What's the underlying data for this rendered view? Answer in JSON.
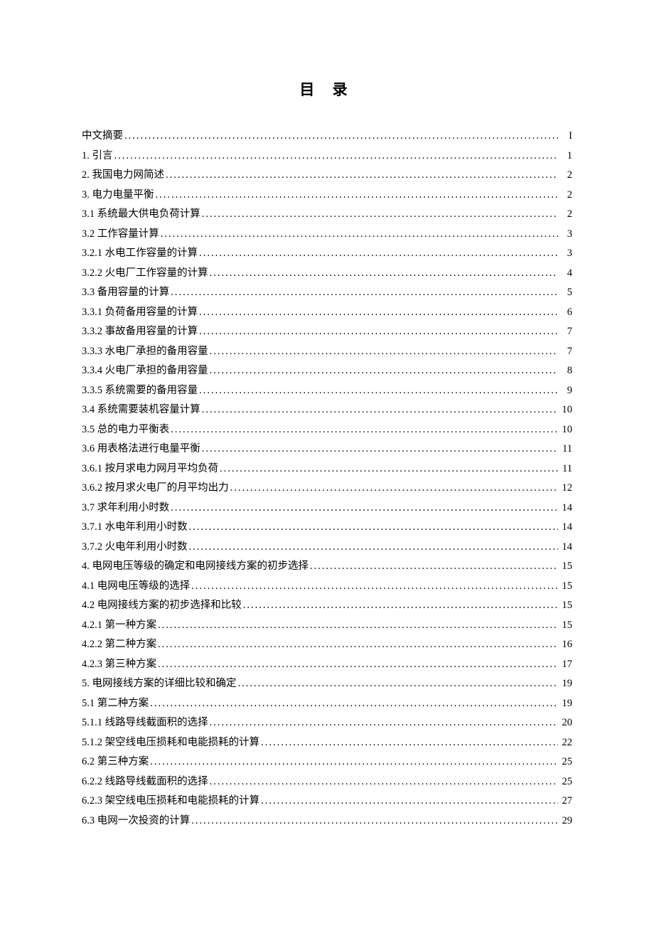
{
  "title": "目  录",
  "entries": [
    {
      "label": "中文摘要",
      "page": "I"
    },
    {
      "label": "1. 引言 ",
      "page": "1"
    },
    {
      "label": "2. 我国电力网简述 ",
      "page": "2"
    },
    {
      "label": "3. 电力电量平衡",
      "page": "2"
    },
    {
      "label": "3.1 系统最大供电负荷计算",
      "page": "2"
    },
    {
      "label": "3.2 工作容量计算",
      "page": "3"
    },
    {
      "label": "3.2.1 水电工作容量的计算",
      "page": "3"
    },
    {
      "label": "3.2.2 火电厂工作容量的计算",
      "page": "4"
    },
    {
      "label": "3.3 备用容量的计算",
      "page": "5"
    },
    {
      "label": "3.3.1 负荷备用容量的计算",
      "page": "6"
    },
    {
      "label": "3.3.2 事故备用容量的计算",
      "page": "7"
    },
    {
      "label": "3.3.3 水电厂承担的备用容量",
      "page": "7"
    },
    {
      "label": "3.3.4 火电厂承担的备用容量",
      "page": "8"
    },
    {
      "label": "3.3.5 系统需要的备用容量",
      "page": "9"
    },
    {
      "label": "3.4 系统需要装机容量计算",
      "page": "10"
    },
    {
      "label": "3.5 总的电力平衡表",
      "page": "10"
    },
    {
      "label": "3.6 用表格法进行电量平衡",
      "page": "11"
    },
    {
      "label": "3.6.1 按月求电力网月平均负荷",
      "page": "11"
    },
    {
      "label": "3.6.2 按月求火电厂的月平均出力",
      "page": "12"
    },
    {
      "label": "3.7 求年利用小时数",
      "page": "14"
    },
    {
      "label": "3.7.1 水电年利用小时数",
      "page": "14"
    },
    {
      "label": "3.7.2 火电年利用小时数",
      "page": "14"
    },
    {
      "label": "4. 电网电压等级的确定和电网接线方案的初步选择 ",
      "page": "15"
    },
    {
      "label": "4.1 电网电压等级的选择",
      "page": "15"
    },
    {
      "label": "4.2 电网接线方案的初步选择和比较",
      "page": "15"
    },
    {
      "label": "4.2.1 第一种方案",
      "page": "15"
    },
    {
      "label": "4.2.2 第二种方案",
      "page": "16"
    },
    {
      "label": "4.2.3 第三种方案",
      "page": "17"
    },
    {
      "label": "5. 电网接线方案的详细比较和确定 ",
      "page": "19"
    },
    {
      "label": "5.1 第二种方案 ",
      "page": "19"
    },
    {
      "label": "5.1.1 线路导线截面积的选择",
      "page": "20"
    },
    {
      "label": "5.1.2 架空线电压损耗和电能损耗的计算",
      "page": "22"
    },
    {
      "label": "6.2 第三种方案 ",
      "page": "25"
    },
    {
      "label": "6.2.2 线路导线截面积的选择",
      "page": "25"
    },
    {
      "label": "6.2.3 架空线电压损耗和电能损耗的计算",
      "page": "27"
    },
    {
      "label": "6.3 电网一次投资的计算",
      "page": "29"
    }
  ]
}
